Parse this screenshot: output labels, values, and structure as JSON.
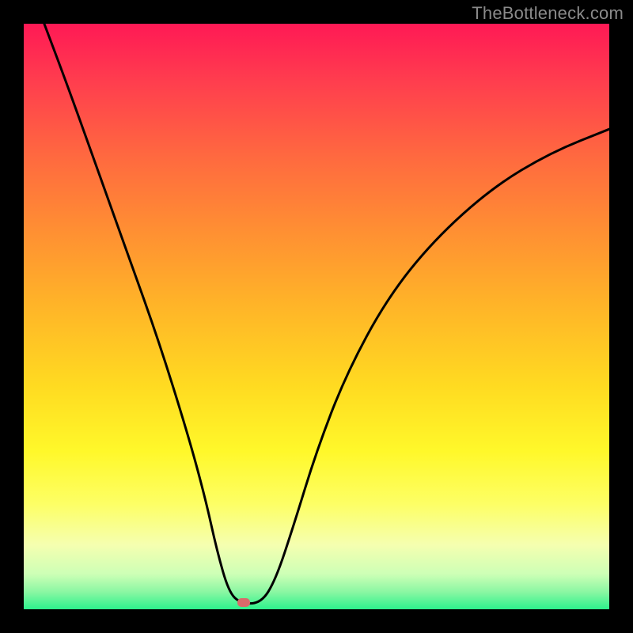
{
  "watermark": "TheBottleneck.com",
  "marker": {
    "x_frac": 0.375,
    "y_frac": 0.988
  },
  "chart_data": {
    "type": "line",
    "title": "",
    "xlabel": "",
    "ylabel": "",
    "xlim": [
      0,
      1
    ],
    "ylim": [
      0,
      1
    ],
    "background_gradient": {
      "top": "#ff1955",
      "bottom": "#2df28c",
      "note": "vertical gradient red→orange→yellow→green representing bottleneck severity, green at bottom = balanced"
    },
    "series": [
      {
        "name": "bottleneck-curve",
        "note": "V-shaped curve with minimum near x≈0.375; y=1 means top of plot (high bottleneck), y≈0 at trough",
        "x": [
          0.035,
          0.08,
          0.13,
          0.18,
          0.23,
          0.28,
          0.31,
          0.33,
          0.35,
          0.37,
          0.405,
          0.43,
          0.46,
          0.5,
          0.55,
          0.62,
          0.7,
          0.8,
          0.9,
          1.0
        ],
        "values": [
          1.0,
          0.88,
          0.74,
          0.6,
          0.46,
          0.3,
          0.19,
          0.1,
          0.03,
          0.01,
          0.01,
          0.05,
          0.14,
          0.27,
          0.4,
          0.53,
          0.63,
          0.72,
          0.78,
          0.82
        ]
      }
    ],
    "marker_point": {
      "x": 0.375,
      "y": 0.012,
      "color": "#d96a6a"
    }
  }
}
